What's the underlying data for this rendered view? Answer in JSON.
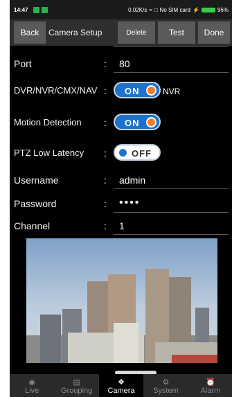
{
  "status_bar": {
    "time": "14:47",
    "network_speed": "0.02K/s",
    "sim_status": "No SIM card",
    "battery": "96%"
  },
  "toolbar": {
    "back_label": "Back",
    "title": "Camera Setup",
    "delete_label": "Delete",
    "test_label": "Test",
    "done_label": "Done"
  },
  "form": {
    "port": {
      "label": "Port",
      "value": "80"
    },
    "device_type": {
      "label": "DVR/NVR/CMX/NAV",
      "toggle": "ON",
      "suffix": "NVR"
    },
    "motion_detection": {
      "label": "Motion Detection",
      "toggle": "ON"
    },
    "ptz_low_latency": {
      "label": "PTZ Low Latency",
      "toggle": "OFF"
    },
    "username": {
      "label": "Username",
      "value": "admin"
    },
    "password": {
      "label": "Password",
      "value": "••••"
    },
    "channel": {
      "label": "Channel",
      "value": "1"
    },
    "colon": ":"
  },
  "tabs": [
    {
      "label": "Live",
      "icon": "live-icon",
      "active": false
    },
    {
      "label": "Grouping",
      "icon": "grouping-icon",
      "active": false
    },
    {
      "label": "Camera",
      "icon": "camera-icon",
      "active": true
    },
    {
      "label": "System",
      "icon": "system-icon",
      "active": false
    },
    {
      "label": "Alarm",
      "icon": "alarm-icon",
      "active": false
    }
  ],
  "colors": {
    "toggle_on": "#1d73c9",
    "toggle_knob_on": "#f07c2a",
    "toolbar_button": "#5a5a5a",
    "battery": "#3ccc4a"
  }
}
